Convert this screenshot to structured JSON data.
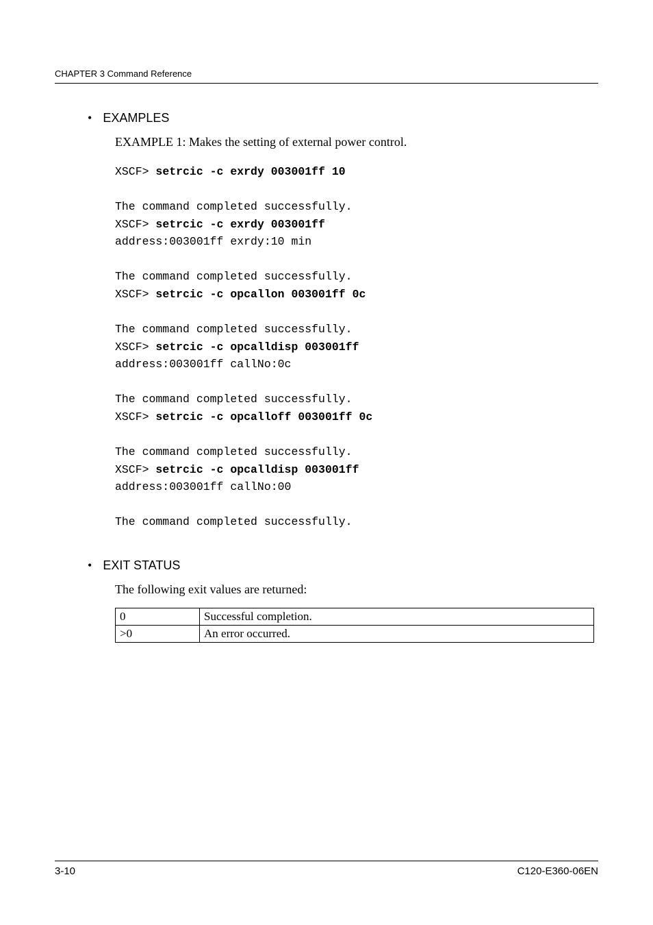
{
  "header": {
    "chapter": "CHAPTER 3  Command Reference"
  },
  "sections": {
    "examples": {
      "heading": "EXAMPLES",
      "example_label": "EXAMPLE 1:  Makes the setting of external power control.",
      "lines": [
        {
          "t": "prompt",
          "prompt": "XSCF> ",
          "cmd": "setrcic -c exrdy 003001ff 10"
        },
        {
          "t": "blank"
        },
        {
          "t": "out",
          "text": "The command completed successfully."
        },
        {
          "t": "prompt",
          "prompt": "XSCF> ",
          "cmd": "setrcic -c exrdy 003001ff"
        },
        {
          "t": "out",
          "text": "address:003001ff exrdy:10 min"
        },
        {
          "t": "blank"
        },
        {
          "t": "out",
          "text": "The command completed successfully."
        },
        {
          "t": "prompt",
          "prompt": "XSCF> ",
          "cmd": "setrcic -c opcallon 003001ff 0c"
        },
        {
          "t": "blank"
        },
        {
          "t": "out",
          "text": "The command completed successfully."
        },
        {
          "t": "prompt",
          "prompt": "XSCF> ",
          "cmd": "setrcic -c opcalldisp 003001ff"
        },
        {
          "t": "out",
          "text": "address:003001ff callNo:0c"
        },
        {
          "t": "blank"
        },
        {
          "t": "out",
          "text": "The command completed successfully."
        },
        {
          "t": "prompt",
          "prompt": "XSCF> ",
          "cmd": "setrcic -c opcalloff 003001ff 0c"
        },
        {
          "t": "blank"
        },
        {
          "t": "out",
          "text": "The command completed successfully."
        },
        {
          "t": "prompt",
          "prompt": "XSCF> ",
          "cmd": "setrcic -c opcalldisp 003001ff"
        },
        {
          "t": "out",
          "text": "address:003001ff callNo:00"
        },
        {
          "t": "blank"
        },
        {
          "t": "out",
          "text": "The command completed successfully."
        }
      ]
    },
    "exit_status": {
      "heading": "EXIT STATUS",
      "intro": "The following exit values are returned:",
      "rows": [
        {
          "code": "0",
          "desc": "Successful completion."
        },
        {
          "code": ">0",
          "desc": "An error occurred."
        }
      ]
    }
  },
  "footer": {
    "left": "3-10",
    "right": "C120-E360-06EN"
  }
}
